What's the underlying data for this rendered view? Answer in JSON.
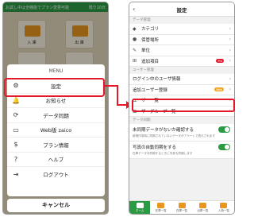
{
  "left": {
    "banner": "お試し中は全機能でプラン変更可能",
    "trial": "残り10日",
    "tiles": [
      "入 庫",
      "出 庫",
      "",
      ""
    ],
    "menu_title": "MENU",
    "menu_items": [
      {
        "label": "設定",
        "icon": "gear-icon",
        "glyph": "⚙"
      },
      {
        "label": "お知らせ",
        "icon": "bell-icon",
        "glyph": "🔔"
      },
      {
        "label": "データ同期",
        "icon": "sync-icon",
        "glyph": "⟳"
      },
      {
        "label": "Web版 zaico",
        "icon": "monitor-icon",
        "glyph": "▭"
      },
      {
        "label": "プラン情報",
        "icon": "currency-icon",
        "glyph": "$"
      },
      {
        "label": "ヘルプ",
        "icon": "help-icon",
        "glyph": "?"
      },
      {
        "label": "ログアウト",
        "icon": "logout-icon",
        "glyph": "⇥"
      }
    ],
    "cancel": "キャンセル"
  },
  "right": {
    "title": "設定",
    "back": "‹",
    "section_data": "データ管理",
    "data_rows": [
      {
        "label": "カテゴリ",
        "icon": "tag-icon",
        "glyph": "◆"
      },
      {
        "label": "保管場所",
        "icon": "location-icon",
        "glyph": "●"
      },
      {
        "label": "単位",
        "icon": "pencil-icon",
        "glyph": "✎"
      },
      {
        "label": "追加項目",
        "icon": "plus-square-icon",
        "glyph": "⊞",
        "badge": "Pro"
      }
    ],
    "section_user": "ユーザー管理",
    "user_rows": [
      {
        "label": "ログイン中のユーザ情報"
      },
      {
        "label": "追加ユーザー登録",
        "badge": "New"
      },
      {
        "label": "ユーザー一覧"
      },
      {
        "label": "ユーザーグループ一覧"
      }
    ],
    "section_sync": "データ同期",
    "toggles": [
      {
        "label": "未同期データがないか確認する",
        "desc": "新規作成時に同期されていないデータがアラートで表示されます"
      },
      {
        "label": "写真の自動同期をする",
        "desc": "在庫データを同期するときに写真も同期します"
      }
    ],
    "nav": [
      {
        "label": "ホーム",
        "active": true
      },
      {
        "label": "在庫一覧",
        "active": false
      },
      {
        "label": "在庫一覧",
        "active": false
      },
      {
        "label": "出庫一覧",
        "active": false
      },
      {
        "label": "入荷一覧",
        "active": false
      }
    ]
  },
  "colors": {
    "accent": "#2c9a43",
    "highlight": "#e5182a",
    "orange": "#e8961e"
  }
}
